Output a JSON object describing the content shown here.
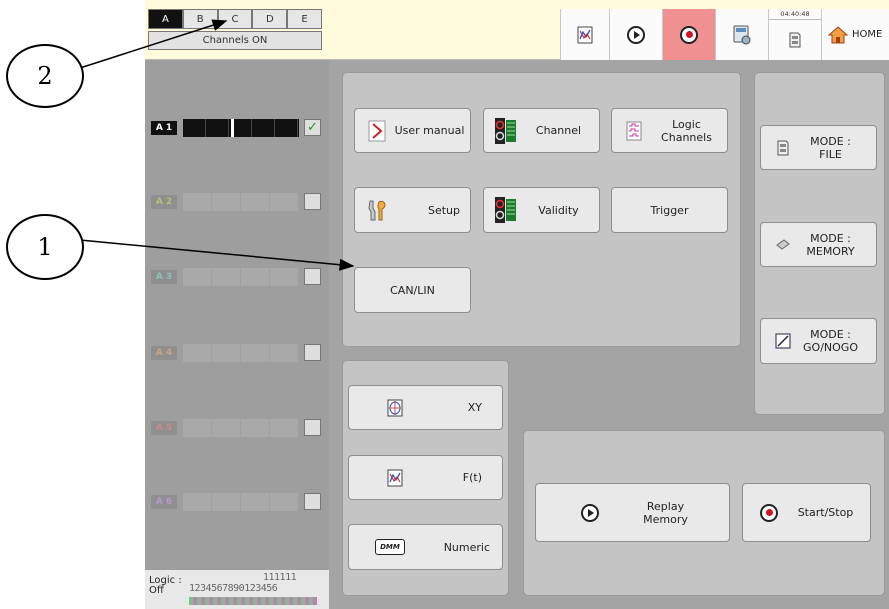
{
  "callouts": {
    "one": "1",
    "two": "2"
  },
  "tabs": [
    "A",
    "B",
    "C",
    "D",
    "E"
  ],
  "channels_on_label": "Channels ON",
  "topbar": {
    "clock": "04:40:48",
    "home_label": "HOME"
  },
  "channels": [
    {
      "label": "A 1",
      "checked": true
    },
    {
      "label": "A 2",
      "checked": false
    },
    {
      "label": "A 3",
      "checked": false
    },
    {
      "label": "A 4",
      "checked": false
    },
    {
      "label": "A 5",
      "checked": false
    },
    {
      "label": "A 6",
      "checked": false
    }
  ],
  "logic": {
    "label_line1": "Logic :",
    "label_line2": "Off",
    "digits_top": "111111",
    "digits_bottom": "1234567890123456"
  },
  "main_buttons": {
    "user_manual": "User manual",
    "channel": "Channel",
    "logic_channels": "Logic\nChannels",
    "setup": "Setup",
    "validity": "Validity",
    "trigger": "Trigger",
    "can_lin": "CAN/LIN"
  },
  "mode_buttons": {
    "file": "MODE :\nFILE",
    "memory": "MODE :\nMEMORY",
    "gonogo": "MODE :\nGO/NOGO"
  },
  "view_buttons": {
    "xy": "XY",
    "ft": "F(t)",
    "numeric": "Numeric",
    "dmm_icon_text": "DMM"
  },
  "action_buttons": {
    "replay": "Replay\nMemory",
    "start_stop": "Start/Stop"
  },
  "colors": {
    "record_bg": "#f19090",
    "panel": "#c4c4c4",
    "left_column": "#9e9e9e",
    "check_green": "#2a8a2a"
  }
}
